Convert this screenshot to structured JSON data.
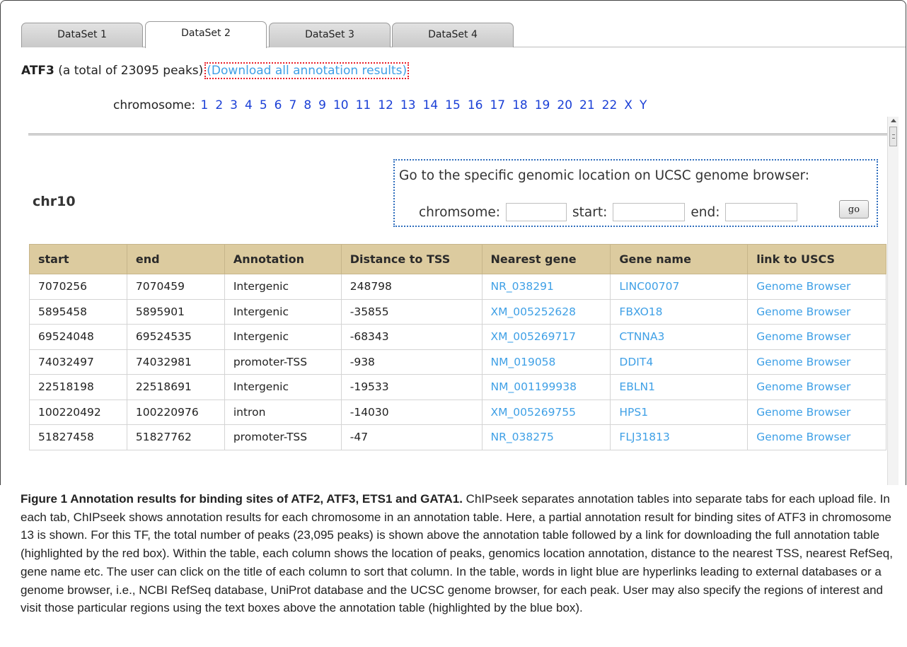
{
  "tabs": [
    {
      "label": "DataSet 1",
      "active": false
    },
    {
      "label": "DataSet 2",
      "active": true
    },
    {
      "label": "DataSet 3",
      "active": false
    },
    {
      "label": "DataSet 4",
      "active": false
    }
  ],
  "header": {
    "tf_name": "ATF3",
    "peak_summary": "(a total of 23095 peaks)",
    "download_link": "(Download all annotation results)"
  },
  "chromosome_bar": {
    "label": "chromosome:",
    "items": [
      "1",
      "2",
      "3",
      "4",
      "5",
      "6",
      "7",
      "8",
      "9",
      "10",
      "11",
      "12",
      "13",
      "14",
      "15",
      "16",
      "17",
      "18",
      "19",
      "20",
      "21",
      "22",
      "X",
      "Y"
    ]
  },
  "current_chromosome": "chr10",
  "ucsc_box": {
    "title": "Go to the specific genomic location on UCSC genome browser:",
    "chromosome_label": "chromsome:",
    "start_label": "start:",
    "end_label": "end:",
    "chromosome_value": "",
    "start_value": "",
    "end_value": "",
    "go_label": "go"
  },
  "table": {
    "columns": [
      "start",
      "end",
      "Annotation",
      "Distance to TSS",
      "Nearest gene",
      "Gene name",
      "link to USCS"
    ],
    "rows": [
      [
        "7070256",
        "7070459",
        "Intergenic",
        "248798",
        "NR_038291",
        "LINC00707",
        "Genome Browser"
      ],
      [
        "5895458",
        "5895901",
        "Intergenic",
        "-35855",
        "XM_005252628",
        "FBXO18",
        "Genome Browser"
      ],
      [
        "69524048",
        "69524535",
        "Intergenic",
        "-68343",
        "XM_005269717",
        "CTNNA3",
        "Genome Browser"
      ],
      [
        "74032497",
        "74032981",
        "promoter-TSS",
        "-938",
        "NM_019058",
        "DDIT4",
        "Genome Browser"
      ],
      [
        "22518198",
        "22518691",
        "Intergenic",
        "-19533",
        "NM_001199938",
        "EBLN1",
        "Genome Browser"
      ],
      [
        "100220492",
        "100220976",
        "intron",
        "-14030",
        "XM_005269755",
        "HPS1",
        "Genome Browser"
      ],
      [
        "51827458",
        "51827762",
        "promoter-TSS",
        "-47",
        "NR_038275",
        "FLJ31813",
        "Genome Browser"
      ]
    ]
  },
  "caption": {
    "heading": "Figure 1 Annotation results for binding sites of ATF2, ATF3, ETS1 and GATA1.",
    "body": "ChIPseek separates annotation tables into separate tabs for each upload file. In each tab, ChIPseek shows annotation results for each chromosome in an annotation table. Here, a partial annotation result for binding sites of ATF3 in chromosome 13 is shown. For this TF, the total number of peaks (23,095 peaks) is shown above the annotation table followed by a link for downloading the full annotation table (highlighted by the red box). Within the table, each column shows the location of peaks, genomics location annotation, distance to the nearest TSS, nearest RefSeq, gene name etc. The user can click on the title of each column to sort that column. In the table, words in light blue are hyperlinks leading to external databases or a genome browser, i.e., NCBI RefSeq database, UniProt database and the UCSC genome browser, for each peak. User may also specify the regions of interest and visit those particular regions using the text boxes above the annotation table (highlighted by the blue box)."
  },
  "colors": {
    "link": "#3fa0e6",
    "chromosome_link": "#1a3fd6",
    "table_header": "#dccb9f",
    "download_highlight": "#e8202a",
    "ucsc_highlight": "#2f6ebd"
  }
}
